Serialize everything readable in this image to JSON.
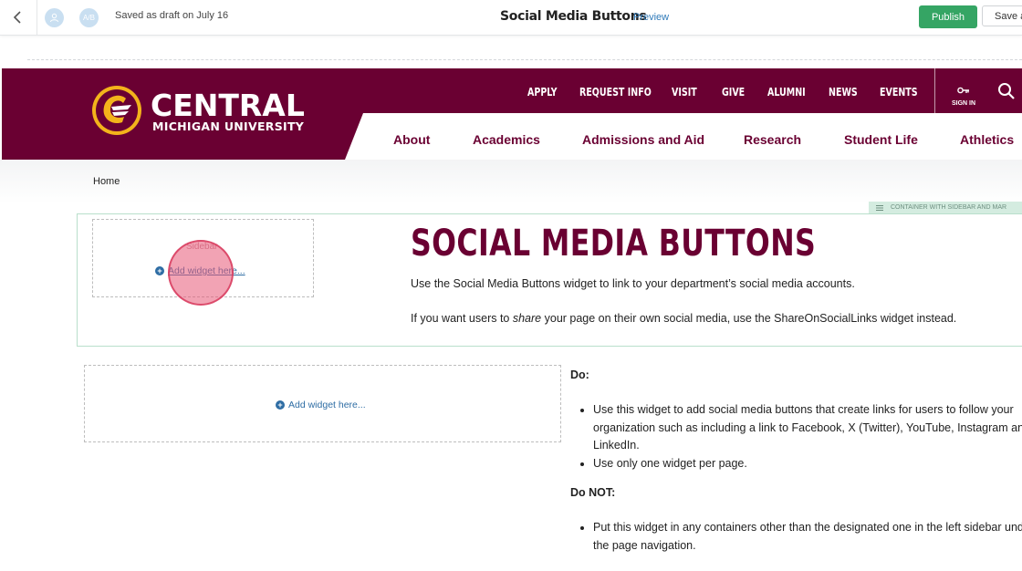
{
  "editor": {
    "back_icon": "chevron-left-icon",
    "user_avatar_icon": "user-icon",
    "ab_badge": "A/B",
    "draft_status": "Saved as draft on July 16",
    "page_title": "Social Media Buttons",
    "preview_label": "Preview",
    "publish_label": "Publish",
    "save_label": "Save a",
    "publish_color": "#35a564"
  },
  "site_header": {
    "brand_color": "#6a0032",
    "logo_line1": "CENTRAL",
    "logo_line2": "MICHIGAN UNIVERSITY",
    "utility_links": [
      "APPLY",
      "REQUEST INFO",
      "VISIT",
      "GIVE",
      "ALUMNI",
      "NEWS",
      "EVENTS"
    ],
    "sign_in_label": "SIGN IN",
    "main_nav": [
      "About",
      "Academics",
      "Admissions and Aid",
      "Research",
      "Student Life",
      "Athletics"
    ]
  },
  "breadcrumb": {
    "home": "Home"
  },
  "container_label": "CONTAINER WITH SIDEBAR AND MAR",
  "sidebar": {
    "label": "Sidebar",
    "add_widget": "Add widget here..."
  },
  "content": {
    "heading": "SOCIAL MEDIA BUTTONS",
    "intro_1": "Use the Social Media Buttons widget to link to your department’s social media accounts.",
    "intro_2_prefix": "If you want users to ",
    "intro_2_emphasis": "share",
    "intro_2_suffix": " your page on their own social media, use the ShareOnSocialLinks widget instead.",
    "lower_add_widget": "Add widget here...",
    "do_heading": "Do:",
    "do_items": [
      "Use this widget to add social media buttons that create links for users to follow your organization such as including a link to Facebook, X (Twitter), YouTube, Instagram and LinkedIn.",
      "Use only one widget per page."
    ],
    "donot_heading": "Do NOT:",
    "donot_items": [
      "Put this widget in any containers other than the designated one in the left sidebar under the page navigation."
    ]
  }
}
